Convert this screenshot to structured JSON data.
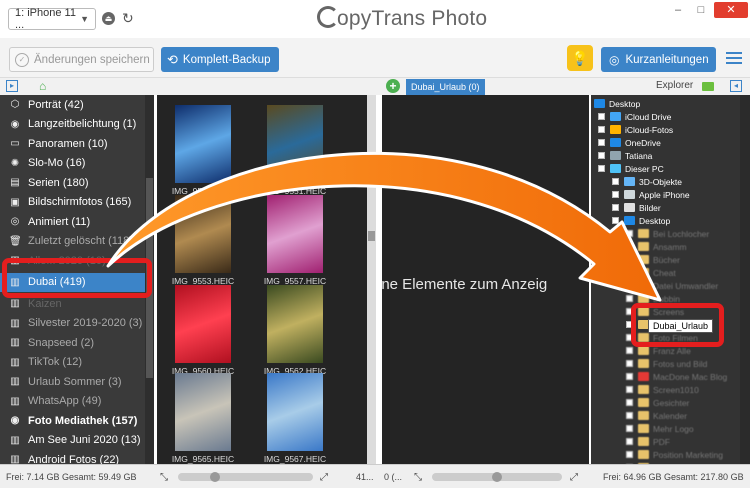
{
  "header": {
    "device": "1: iPhone 11 ...",
    "title_prefix": "C",
    "title_rest": "opyTrans Photo",
    "window_controls": {
      "minimize": "–",
      "maximize": "□",
      "close": "✕"
    }
  },
  "toolbar": {
    "save_label": "Änderungen speichern",
    "backup_label": "Komplett-Backup",
    "guides_label": "Kurzanleitungen"
  },
  "subheader": {
    "album_tab": "Dubai_Urlaub (0)",
    "explorer_label": "Explorer"
  },
  "sidebar": {
    "items": [
      {
        "label": "Porträt (42)",
        "icon": "cube-icon",
        "style": "normal"
      },
      {
        "label": "Langzeitbelichtung (1)",
        "icon": "camera-icon",
        "style": "normal"
      },
      {
        "label": "Panoramen (10)",
        "icon": "panorama-icon",
        "style": "normal"
      },
      {
        "label": "Slo-Mo (16)",
        "icon": "slowmo-icon",
        "style": "normal"
      },
      {
        "label": "Serien (180)",
        "icon": "burst-icon",
        "style": "normal"
      },
      {
        "label": "Bildschirmfotos (165)",
        "icon": "screenshot-icon",
        "style": "normal"
      },
      {
        "label": "Animiert (11)",
        "icon": "animated-icon",
        "style": "normal"
      },
      {
        "label": "Zuletzt gelöscht (118)",
        "icon": "trash-icon",
        "style": "dim"
      },
      {
        "label": "Alle... 2020 (10)",
        "icon": "album-icon",
        "style": "blur"
      },
      {
        "label": "Dubai (419)",
        "icon": "album-icon",
        "style": "selected"
      },
      {
        "label": "Kaizen",
        "icon": "album-icon",
        "style": "blur"
      },
      {
        "label": "Silvester 2019-2020 (3)",
        "icon": "album-icon",
        "style": "dim"
      },
      {
        "label": "Snapseed (2)",
        "icon": "album-icon",
        "style": "dim"
      },
      {
        "label": "TikTok (12)",
        "icon": "album-icon",
        "style": "dim"
      },
      {
        "label": "Urlaub Sommer (3)",
        "icon": "album-icon",
        "style": "dim"
      },
      {
        "label": "WhatsApp (49)",
        "icon": "album-icon",
        "style": "dim"
      },
      {
        "label": "Foto Mediathek (157)",
        "icon": "camera-icon",
        "style": "group"
      },
      {
        "label": "Am See Juni 2020 (13)",
        "icon": "album-icon",
        "style": "normal"
      },
      {
        "label": "Android Fotos (22)",
        "icon": "album-icon",
        "style": "normal"
      }
    ]
  },
  "photos": [
    {
      "name": "IMG_9547.HEIC",
      "c1": "#0e2d6b",
      "c2": "#5ea7e6"
    },
    {
      "name": "IMG_9551.HEIC",
      "c1": "#5a4a20",
      "c2": "#2a6a9a"
    },
    {
      "name": "IMG_9553.HEIC",
      "c1": "#3a2a18",
      "c2": "#b08a50"
    },
    {
      "name": "IMG_9557.HEIC",
      "c1": "#a02070",
      "c2": "#e0a0d0"
    },
    {
      "name": "IMG_9560.HEIC",
      "c1": "#b01020",
      "c2": "#ff4050"
    },
    {
      "name": "IMG_9562.HEIC",
      "c1": "#3a4a20",
      "c2": "#c0b060"
    },
    {
      "name": "IMG_9565.HEIC",
      "c1": "#6a7a90",
      "c2": "#c8c4b8"
    },
    {
      "name": "IMG_9567.HEIC",
      "c1": "#3a78c8",
      "c2": "#a8cce8"
    }
  ],
  "album": {
    "empty_message": "ine Elemente zum Anzeig"
  },
  "explorer": {
    "items": [
      {
        "label": "Desktop",
        "indent": 0,
        "cb": false,
        "color": "#1e88e5",
        "blur": false
      },
      {
        "label": "iCloud Drive",
        "indent": 1,
        "cb": true,
        "color": "#42a5f5",
        "blur": false
      },
      {
        "label": "iCloud-Fotos",
        "indent": 1,
        "cb": true,
        "color": "#ffb300",
        "blur": false
      },
      {
        "label": "OneDrive",
        "indent": 1,
        "cb": true,
        "color": "#1e88e5",
        "blur": false
      },
      {
        "label": "Tatiana",
        "indent": 1,
        "cb": true,
        "color": "#90a4ae",
        "blur": false
      },
      {
        "label": "Dieser PC",
        "indent": 1,
        "cb": true,
        "color": "#4fc3f7",
        "blur": false
      },
      {
        "label": "3D-Objekte",
        "indent": 2,
        "cb": true,
        "color": "#64b5f6",
        "blur": false
      },
      {
        "label": "Apple iPhone",
        "indent": 2,
        "cb": true,
        "color": "#cfd8dc",
        "blur": false
      },
      {
        "label": "Bilder",
        "indent": 2,
        "cb": true,
        "color": "#e0e0e0",
        "blur": false
      },
      {
        "label": "Desktop",
        "indent": 2,
        "cb": true,
        "color": "#1e88e5",
        "blur": false
      },
      {
        "label": "Bei Lochlocher",
        "indent": 3,
        "cb": true,
        "color": "#e8c36a",
        "blur": true
      },
      {
        "label": "Ansamm",
        "indent": 3,
        "cb": true,
        "color": "#e8c36a",
        "blur": true
      },
      {
        "label": "Bücher",
        "indent": 3,
        "cb": true,
        "color": "#e8c36a",
        "blur": true
      },
      {
        "label": "Cheat",
        "indent": 3,
        "cb": true,
        "color": "#e8c36a",
        "blur": true
      },
      {
        "label": "Datei Umwandler",
        "indent": 3,
        "cb": true,
        "color": "#e8c36a",
        "blur": true
      },
      {
        "label": "Dubbin",
        "indent": 3,
        "cb": true,
        "color": "#e8c36a",
        "blur": true
      },
      {
        "label": "Screens",
        "indent": 3,
        "cb": true,
        "color": "#e8c36a",
        "blur": true
      },
      {
        "label": "Dubai_Urlaub",
        "indent": 3,
        "cb": true,
        "color": "#e8c36a",
        "blur": false
      },
      {
        "label": "Foto Filmen",
        "indent": 3,
        "cb": true,
        "color": "#e8c36a",
        "blur": true
      },
      {
        "label": "Franz Alle",
        "indent": 3,
        "cb": true,
        "color": "#e8c36a",
        "blur": true
      },
      {
        "label": "Fotos und Bild",
        "indent": 3,
        "cb": true,
        "color": "#e8c36a",
        "blur": true
      },
      {
        "label": "MacDone Mac Blog",
        "indent": 3,
        "cb": true,
        "color": "#e53935",
        "blur": true
      },
      {
        "label": "Screen1010",
        "indent": 3,
        "cb": true,
        "color": "#e8c36a",
        "blur": true
      },
      {
        "label": "Gesichter",
        "indent": 3,
        "cb": true,
        "color": "#e8c36a",
        "blur": true
      },
      {
        "label": "Kalender",
        "indent": 3,
        "cb": true,
        "color": "#e8c36a",
        "blur": true
      },
      {
        "label": "Mehr Logo",
        "indent": 3,
        "cb": true,
        "color": "#e8c36a",
        "blur": true
      },
      {
        "label": "PDF",
        "indent": 3,
        "cb": true,
        "color": "#e8c36a",
        "blur": true
      },
      {
        "label": "Position Marketing",
        "indent": 3,
        "cb": true,
        "color": "#e8c36a",
        "blur": true
      },
      {
        "label": "REC",
        "indent": 3,
        "cb": true,
        "color": "#e8c36a",
        "blur": true
      }
    ]
  },
  "status": {
    "left": "Frei: 7.14 GB Gesamt: 59.49 GB",
    "photos_count": "41...",
    "album_count": "0 (...",
    "right": "Frei: 64.96 GB Gesamt: 217.80 GB"
  },
  "overlay": {
    "drop_label": "Dubai_Urlaub",
    "arrow_color": "#f47c10",
    "highlight_color": "#e41e1e"
  },
  "colors": {
    "accent": "#3c84c8",
    "sidebar_bg": "#3a3a3a",
    "pane_bg": "#242424",
    "close": "#e23d2e",
    "bulb": "#f7c21a"
  }
}
